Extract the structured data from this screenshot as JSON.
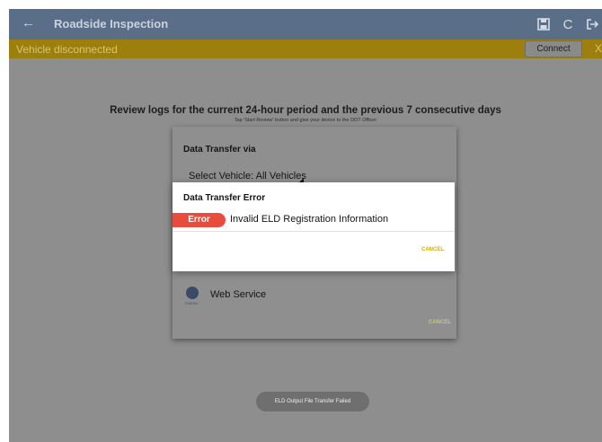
{
  "appbar": {
    "back_icon": "arrow-back-icon",
    "title": "Roadside Inspection",
    "icons": [
      "save-icon",
      "refresh-icon",
      "logout-icon"
    ]
  },
  "status": {
    "text": "Vehicle disconnected",
    "connect_label": "Connect",
    "close_label": "X"
  },
  "review": {
    "title": "Review logs for the current 24-hour period and the previous 7 consecutive days",
    "subtitle": "Tap 'Start Review' button and give your device to the DOT Officer"
  },
  "data_transfer": {
    "title": "Data Transfer via",
    "select_vehicle": "Select Vehicle:  All Vehicles",
    "web_service_label": "Web Service",
    "web_service_icon_text": "FMCSA",
    "cancel_label": "CANCEL"
  },
  "error_dialog": {
    "title": "Data Transfer Error",
    "badge": "Error",
    "message": "Invalid ELD Registration Information",
    "cancel_label": "CANCEL"
  },
  "toast": {
    "text": "ELD Output File Transfer Failed"
  },
  "colors": {
    "appbar": "#5b6e87",
    "statusbar": "#9c7f0c",
    "error_red": "#e74c3c",
    "cancel_yellow": "#d4b000"
  }
}
